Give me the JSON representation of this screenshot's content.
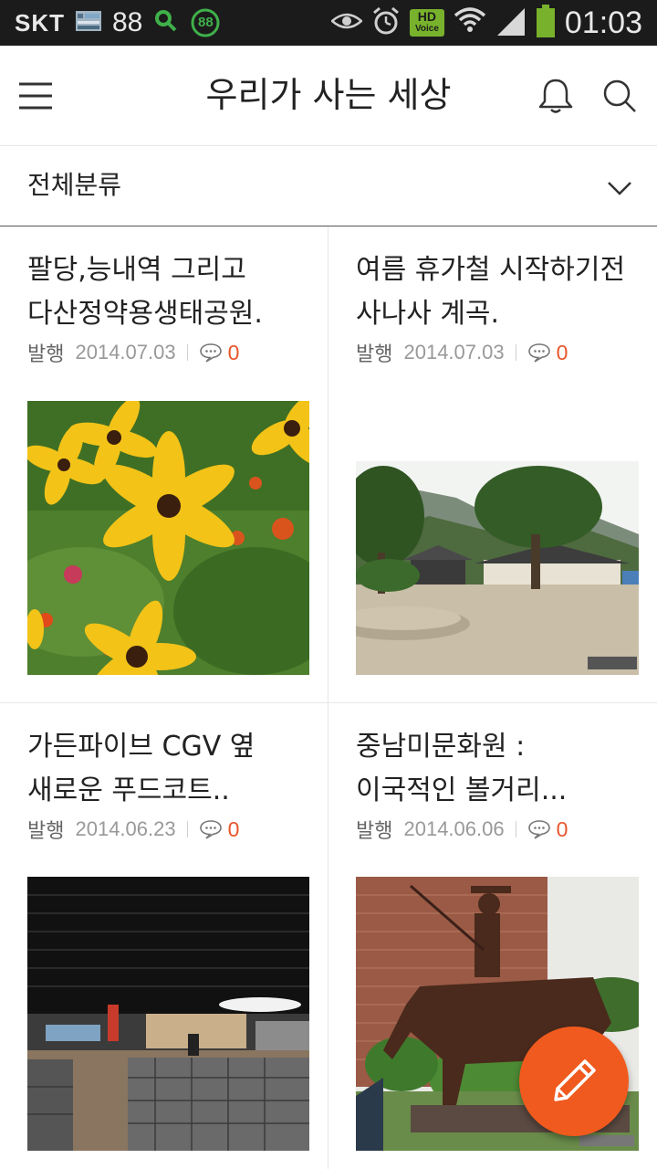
{
  "status_bar": {
    "carrier": "SKT",
    "signal_num": "88",
    "battery_badge": "88",
    "hd_top": "HD",
    "hd_bottom": "Voice",
    "time": "01:03"
  },
  "app_bar": {
    "title": "우리가 사는 세상",
    "icons": [
      "menu-icon",
      "bell-icon",
      "search-icon"
    ]
  },
  "category": {
    "selected": "전체분류"
  },
  "posts": [
    {
      "title_line1": "팔당,능내역 그리고",
      "title_line2": "다산정약용생태공원.",
      "status": "발행",
      "date": "2014.07.03",
      "comments": "0"
    },
    {
      "title_line1": "여름 휴가철 시작하기전",
      "title_line2": "사나사 계곡.",
      "status": "발행",
      "date": "2014.07.03",
      "comments": "0"
    },
    {
      "title_line1": "가든파이브 CGV 옆",
      "title_line2": "새로운 푸드코트..",
      "status": "발행",
      "date": "2014.06.23",
      "comments": "0"
    },
    {
      "title_line1": "중남미문화원 :",
      "title_line2": "이국적인 볼거리...",
      "status": "발행",
      "date": "2014.06.06",
      "comments": "0"
    }
  ],
  "colors": {
    "accent": "#f05a1e",
    "comment_count": "#e8552b",
    "status_bar": "#1b1b1b"
  }
}
